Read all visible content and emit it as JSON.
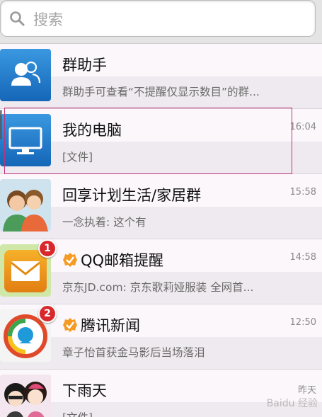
{
  "search": {
    "placeholder": "搜索"
  },
  "conversations": [
    {
      "name": "群助手",
      "preview": "群助手可查看“不提醒仅显示数目”的群...",
      "time": ""
    },
    {
      "name": "我的电脑",
      "preview": "[文件]",
      "time": "16:04"
    },
    {
      "name": "回享计划生活/家居群",
      "preview": "一念执着: 这个有",
      "time": "15:58"
    },
    {
      "name": "QQ邮箱提醒",
      "preview": "京东JD.com:  京东歌莉娅服装 全网首...",
      "time": "14:58",
      "unread": "1"
    },
    {
      "name": "腾讯新闻",
      "preview": "章子怡首获金马影后当场落泪",
      "time": "12:50",
      "unread": "2"
    },
    {
      "name": "下雨天",
      "preview": "[文件]",
      "time": "昨天"
    }
  ],
  "watermark": "Baidu 经验",
  "colors": {
    "highlight": "#c0347a",
    "unread_badge": "#d8282c",
    "verified": "#f59a23",
    "app_blue": "#1a7fd0"
  }
}
